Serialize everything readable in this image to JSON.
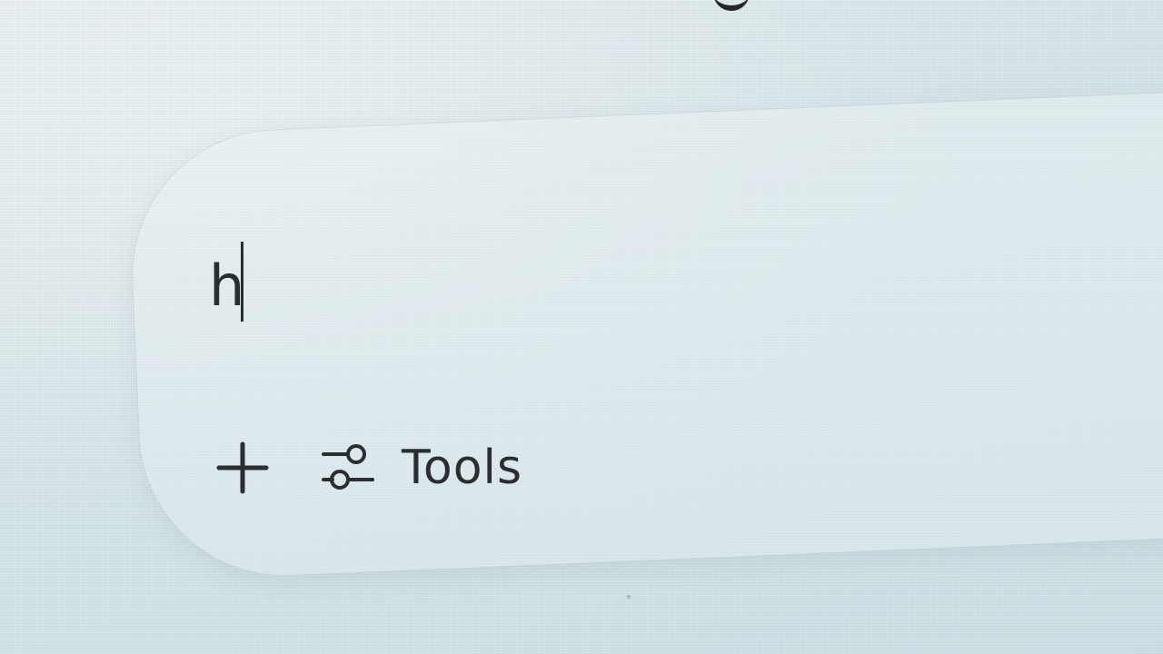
{
  "composer": {
    "typed_text": "h",
    "add_button_icon": "plus-icon",
    "tools_button": {
      "icon": "sliders-icon",
      "label": "Tools"
    }
  },
  "colors": {
    "background": "#d7e6ea",
    "text": "#2a2e31"
  }
}
